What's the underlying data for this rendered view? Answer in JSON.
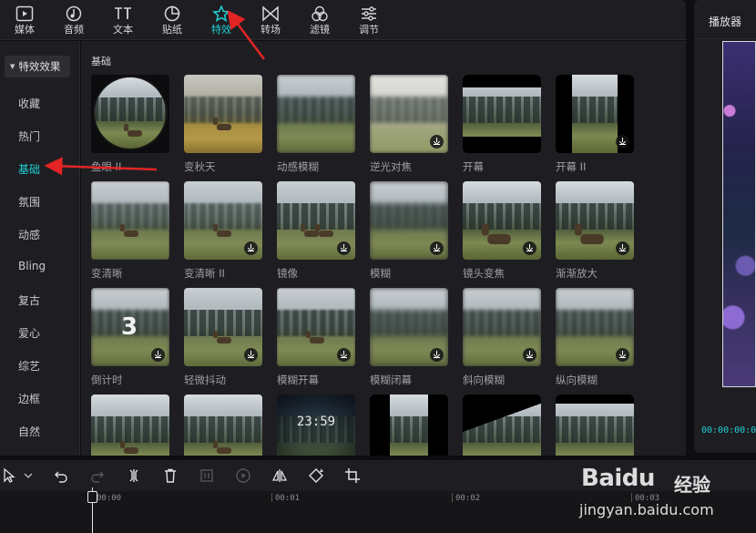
{
  "toolbar": {
    "tabs": [
      {
        "label": "媒体",
        "icon": "media-icon"
      },
      {
        "label": "音频",
        "icon": "audio-icon"
      },
      {
        "label": "文本",
        "icon": "text-icon"
      },
      {
        "label": "贴纸",
        "icon": "sticker-icon"
      },
      {
        "label": "特效",
        "icon": "effects-icon",
        "active": true
      },
      {
        "label": "转场",
        "icon": "transition-icon"
      },
      {
        "label": "滤镜",
        "icon": "filter-icon"
      },
      {
        "label": "调节",
        "icon": "adjust-icon"
      }
    ],
    "accent_color": "#1fd1d6"
  },
  "sidebar": {
    "header": "特效效果",
    "items": [
      "收藏",
      "热门",
      "基础",
      "氛围",
      "动感",
      "Bling",
      "复古",
      "爱心",
      "综艺",
      "边框",
      "自然"
    ],
    "active": "基础"
  },
  "content": {
    "section_title": "基础",
    "effects": [
      {
        "name": "鱼眼 II"
      },
      {
        "name": "变秋天"
      },
      {
        "name": "动感模糊"
      },
      {
        "name": "逆光对焦"
      },
      {
        "name": "开幕"
      },
      {
        "name": "开幕 II"
      },
      {
        "name": "变清晰"
      },
      {
        "name": "变清晰 II"
      },
      {
        "name": "镜像"
      },
      {
        "name": "模糊"
      },
      {
        "name": "镜头变焦"
      },
      {
        "name": "渐渐放大"
      },
      {
        "name": "倒计时",
        "overlay": "3"
      },
      {
        "name": "轻微抖动"
      },
      {
        "name": "模糊开幕"
      },
      {
        "name": "模糊闭幕"
      },
      {
        "name": "斜向模糊"
      },
      {
        "name": "纵向模糊"
      },
      {
        "name": ""
      },
      {
        "name": ""
      },
      {
        "name": "",
        "overlay": "23:59"
      },
      {
        "name": ""
      },
      {
        "name": ""
      },
      {
        "name": ""
      }
    ]
  },
  "preview": {
    "title": "播放器",
    "time": "00:00:00:00"
  },
  "timeline": {
    "ticks": [
      "00:00",
      "00:01",
      "00:02",
      "00:03"
    ]
  },
  "watermark": {
    "logo": "Baidu",
    "text": "经验",
    "url": "jingyan.baidu.com"
  }
}
